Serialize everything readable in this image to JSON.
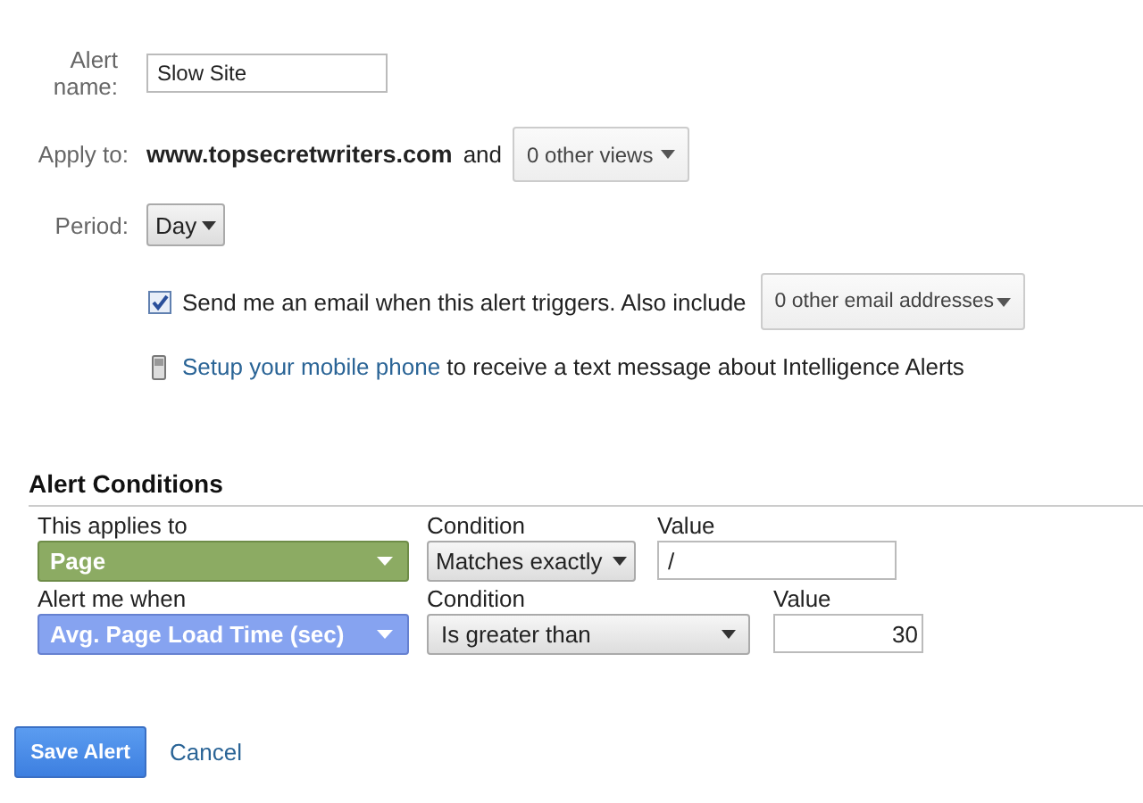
{
  "alert_name": {
    "label": "Alert name:",
    "value": "Slow Site"
  },
  "apply_to": {
    "label": "Apply to:",
    "site": "www.topsecretwriters.com",
    "connector": "and",
    "views": "0 other views"
  },
  "period": {
    "label": "Period:",
    "value": "Day"
  },
  "email": {
    "checked": true,
    "label": "Send me an email when this alert triggers. Also include",
    "addresses": "0 other email addresses"
  },
  "mobile": {
    "link": "Setup your mobile phone",
    "text": "to receive a text message about Intelligence Alerts"
  },
  "conditions": {
    "title": "Alert Conditions",
    "rows": [
      {
        "kind": "dimension",
        "label": "This applies to",
        "field": "Page",
        "condition_label": "Condition",
        "condition": "Matches exactly",
        "value_label": "Value",
        "value": "/"
      },
      {
        "kind": "metric",
        "label": "Alert me when",
        "field": "Avg. Page Load Time (sec)",
        "condition_label": "Condition",
        "condition": "Is greater than",
        "value_label": "Value",
        "value": "30"
      }
    ]
  },
  "buttons": {
    "save": "Save Alert",
    "cancel": "Cancel"
  }
}
